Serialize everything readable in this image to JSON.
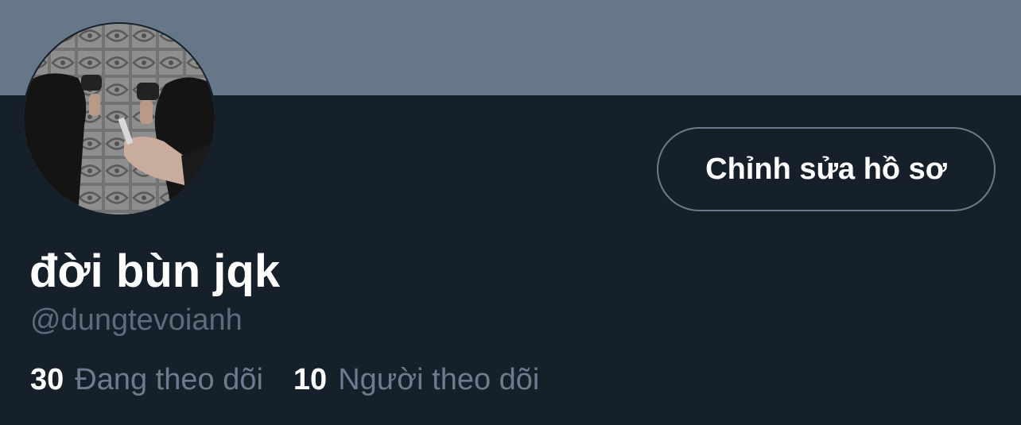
{
  "profile": {
    "display_name": "đời bùn jqk",
    "handle": "@dungtevoianh",
    "edit_button_label": "Chỉnh sửa hồ sơ"
  },
  "stats": {
    "following": {
      "count": "30",
      "label": "Đang theo dõi"
    },
    "followers": {
      "count": "10",
      "label": "Người theo dõi"
    }
  },
  "colors": {
    "background": "#15202b",
    "banner": "#667788",
    "secondary_text": "#6b7c8e",
    "button_border": "#6b7b8b"
  }
}
